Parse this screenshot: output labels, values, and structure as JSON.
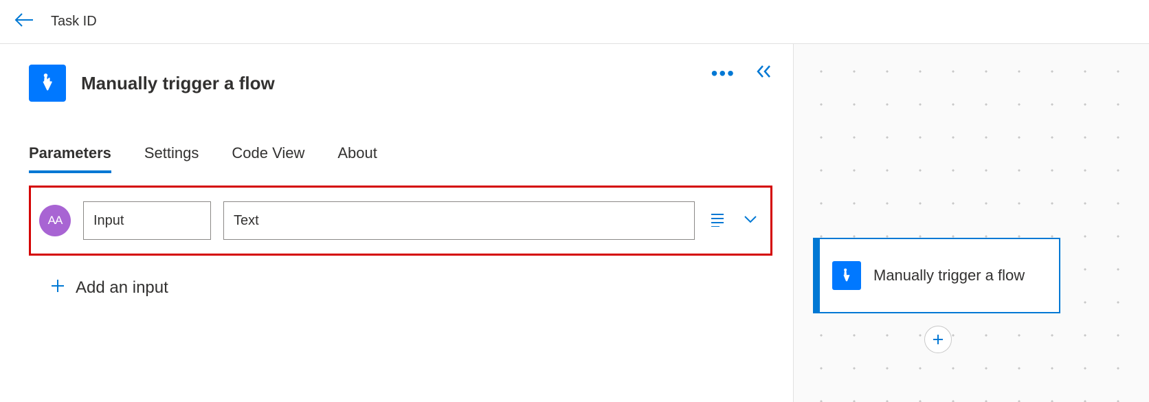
{
  "topbar": {
    "title": "Task ID"
  },
  "panel": {
    "title": "Manually trigger a flow",
    "tabs": [
      {
        "label": "Parameters",
        "active": true
      },
      {
        "label": "Settings",
        "active": false
      },
      {
        "label": "Code View",
        "active": false
      },
      {
        "label": "About",
        "active": false
      }
    ],
    "input_row": {
      "type_badge": "AA",
      "name_value": "Input",
      "value_value": "Text"
    },
    "add_input_label": "Add an input"
  },
  "canvas": {
    "node_label": "Manually trigger a flow"
  }
}
